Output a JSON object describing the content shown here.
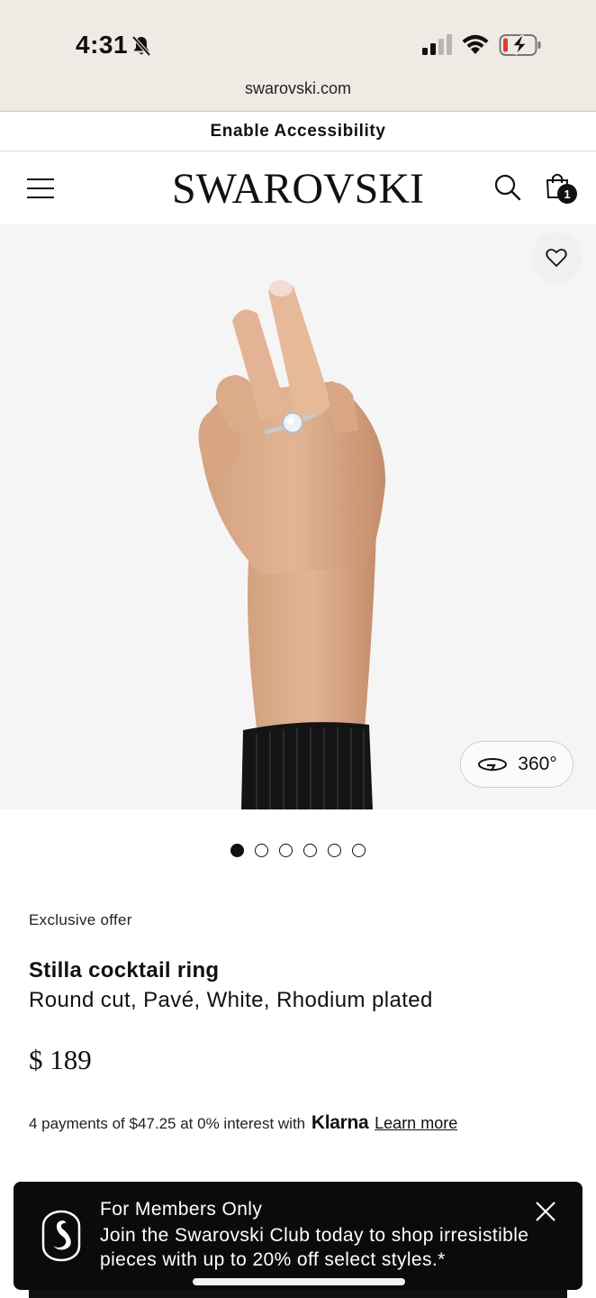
{
  "status_bar": {
    "time": "4:31"
  },
  "browser": {
    "url": "swarovski.com"
  },
  "accessibility_bar": {
    "label": "Enable Accessibility"
  },
  "header": {
    "logo": "SWAROVSKI",
    "cart_count": "1"
  },
  "product_image": {
    "view_360_label": "360°",
    "image_count": 6,
    "active_image": 1
  },
  "product": {
    "offer_label": "Exclusive offer",
    "name": "Stilla cocktail ring",
    "description": "Round cut, Pavé, White, Rhodium plated",
    "price": "$ 189",
    "installments_text": "4 payments of $47.25 at 0% interest with",
    "klarna_label": "Klarna",
    "learn_more": "Learn more"
  },
  "members_banner": {
    "title": "For Members Only",
    "text": "Join the Swarovski Club today to shop irresistible pieces with up to 20% off select styles.*"
  },
  "colors": {
    "status_background": "#efebe4",
    "banner_background": "#0b0b0b",
    "battery_low": "#e53935"
  }
}
